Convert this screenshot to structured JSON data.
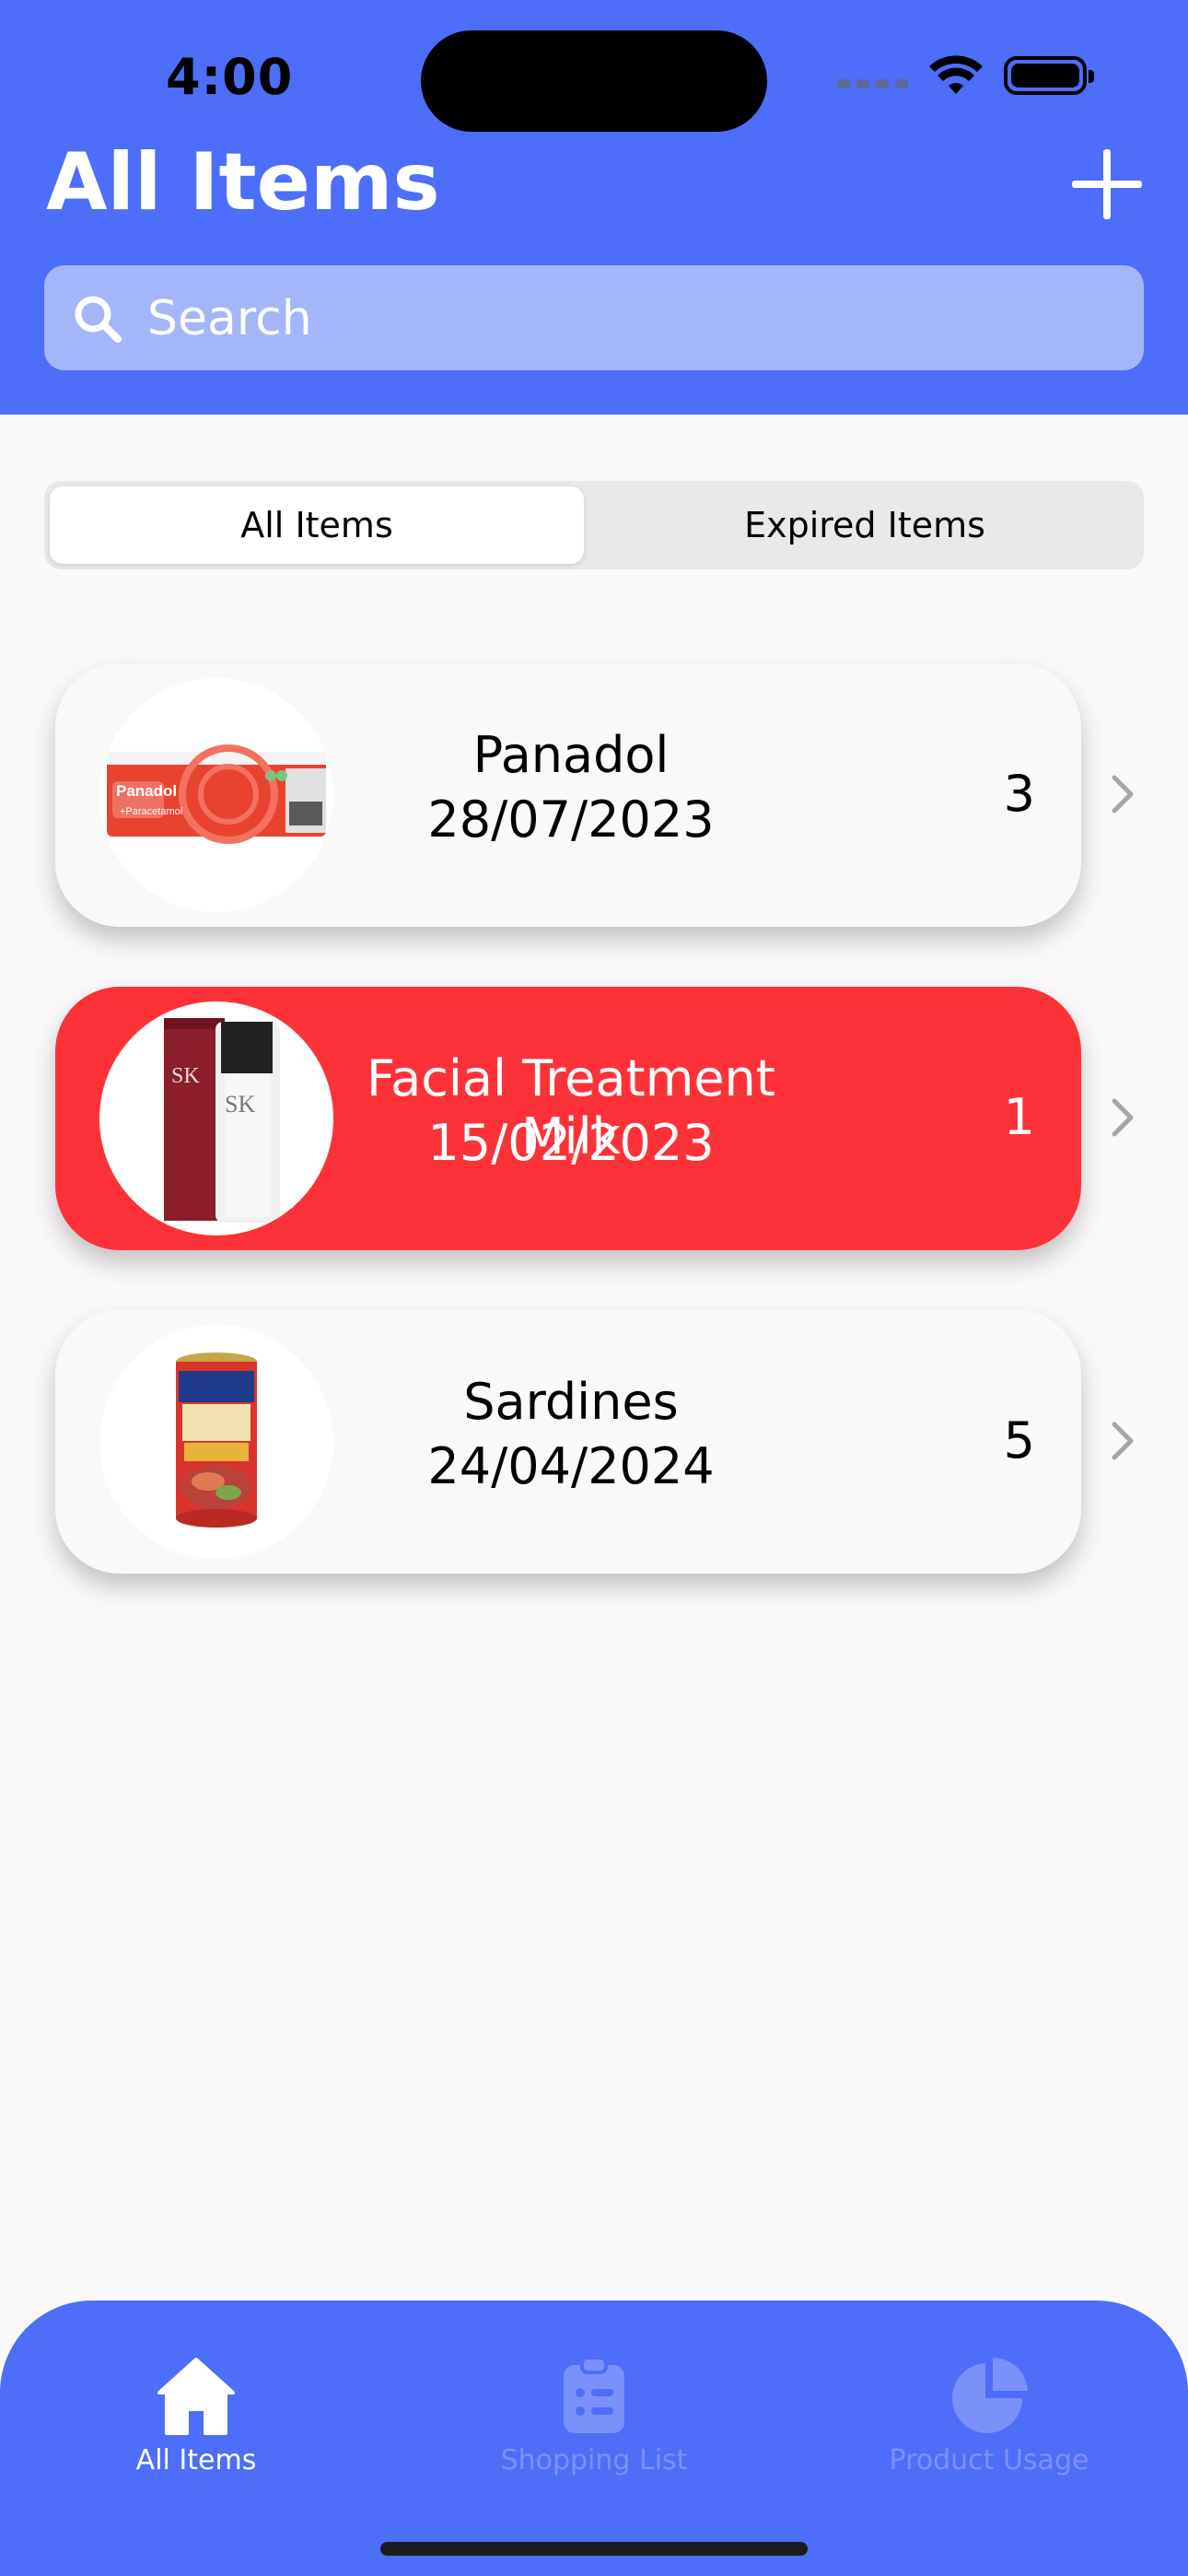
{
  "status_bar": {
    "time": "4:00"
  },
  "header": {
    "title": "All Items"
  },
  "search": {
    "placeholder": "Search"
  },
  "segments": {
    "all": "All Items",
    "expired": "Expired Items"
  },
  "items": [
    {
      "name": "Panadol",
      "date": "28/07/2023",
      "qty": "3",
      "expired": false,
      "image": "panadol-box"
    },
    {
      "name": "Facial Treatment Milk",
      "date": "15/02/2023",
      "qty": "1",
      "expired": true,
      "image": "sk-ii-bottle"
    },
    {
      "name": "Sardines",
      "date": "24/04/2024",
      "qty": "5",
      "expired": false,
      "image": "sardine-can"
    }
  ],
  "tabs": [
    {
      "label": "All Items",
      "icon": "house-icon",
      "active": true
    },
    {
      "label": "Shopping List",
      "icon": "clipboard-list-icon",
      "active": false
    },
    {
      "label": "Product Usage",
      "icon": "pie-chart-icon",
      "active": false
    }
  ],
  "colors": {
    "primary": "#4c6ef8",
    "expired": "#fd3238",
    "search_bg": "#a4b5fa",
    "tab_inactive": "#7b91fa"
  }
}
